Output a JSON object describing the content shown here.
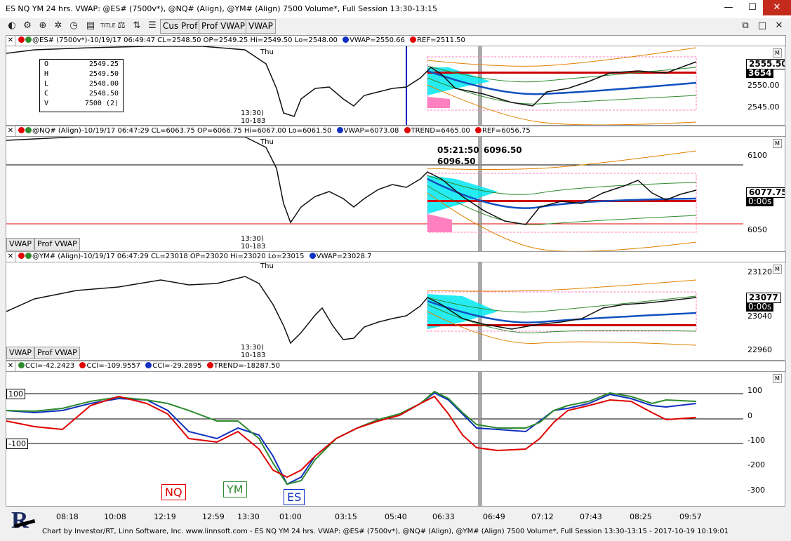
{
  "window": {
    "title": "ES NQ YM 24 hrs. VWAP: @ES# (7500v*), @NQ# (Align), @YM# (Align) 7500 Volume*, Full Session 13:30-13:15",
    "min_label": "—",
    "max_label": "☐",
    "close_label": "✕"
  },
  "toolbar": {
    "icons": [
      "chart-icon",
      "gear-icon",
      "zoom-icon",
      "settings-icon",
      "clock-icon",
      "title-icon",
      "scales-icon",
      "compare-icon",
      "sliders-icon"
    ],
    "buttons": [
      "Cus Prof",
      "Prof VWAP",
      "VWAP"
    ],
    "right_icons": [
      "⧉",
      "□",
      "✕"
    ]
  },
  "panes": {
    "es": {
      "header": "@ES# (7500v*)-10/19/17 06:49:47 CL=2548.50 OP=2549.25 Hi=2549.50 Lo=2548.00",
      "vwap": "VWAP=2550.66",
      "ref": "REF=2511.50",
      "ticks": [
        "2550.00",
        "2545.00"
      ],
      "last_price": "2555.50",
      "volume": "3654",
      "day_label": "Thu",
      "session_time": "13:30)",
      "session_date": "10-183",
      "ohlc": [
        [
          "O",
          "2549.25"
        ],
        [
          "H",
          "2549.50"
        ],
        [
          "L",
          "2548.00"
        ],
        [
          "C",
          "2548.50"
        ],
        [
          "V",
          "7500 (2)"
        ]
      ],
      "m": "M"
    },
    "nq": {
      "header": "@NQ# (Align)-10/19/17 06:47:29 CL=6063.75 OP=6066.75 Hi=6067.00 Lo=6061.50",
      "vwap": "VWAP=6073.08",
      "trend": "TREND=6465.00",
      "ref": "REF=6056.75",
      "ticks": [
        "6100",
        "6050"
      ],
      "last_price": "6077.75",
      "countdown": "0:00s",
      "cursor_time": "05:21:50",
      "cursor_price": "6096.50",
      "cursor_price2": "6096.50",
      "day_label": "Thu",
      "session_time": "13:30)",
      "session_date": "10-183",
      "btn_vwap": "VWAP",
      "btn_prof": "Prof VWAP",
      "m": "M"
    },
    "ym": {
      "header": "@YM# (Align)-10/19/17 06:47:29 CL=23018 OP=23020 Hi=23020 Lo=23015",
      "vwap": "VWAP=23028.7",
      "ticks": [
        "23120",
        "23040",
        "22960"
      ],
      "last_price": "23077",
      "countdown": "0:00s",
      "day_label": "Thu",
      "session_time": "13:30)",
      "session_date": "10-183",
      "btn_vwap": "VWAP",
      "btn_prof": "Prof VWAP",
      "m": "M"
    },
    "cci": {
      "cci1": "CCI=-42.2423",
      "cci2": "CCI=-109.9557",
      "cci3": "CCI=-29.2895",
      "trend": "TREND=-18287.50",
      "ticks": [
        "100",
        "0",
        "-100",
        "-200",
        "-300"
      ],
      "lvl_hi": "100",
      "lvl_lo": "-100",
      "legend_nq": "NQ",
      "legend_ym": "YM",
      "legend_es": "ES",
      "m": "M"
    }
  },
  "time_axis": [
    "08:18",
    "10:08",
    "12:19",
    "12:59",
    "13:30",
    "01:00",
    "03:15",
    "05:40",
    "06:33",
    "06:49",
    "07:12",
    "07:43",
    "08:25",
    "09:57"
  ],
  "status": "Chart by Investor/RT, Linn Software, Inc. www.linnsoft.com - ES NQ YM 24 hrs. VWAP: @ES# (7500v*), @NQ# (Align), @YM# (Align) 7500 Volume*, Full Session 13:30-13:15 - 2017-10-19 10:19:01",
  "colors": {
    "green": "#2e8b2e",
    "red": "#e00000",
    "blue": "#1030c0",
    "cyan": "#00e0e8",
    "pink": "#ff80c0",
    "darkred": "#cc0000",
    "orange": "#e08000"
  }
}
